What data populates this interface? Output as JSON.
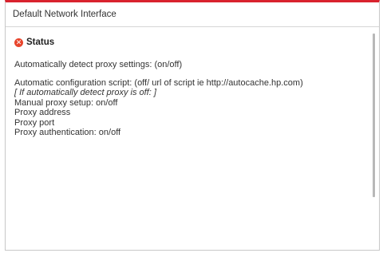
{
  "panel": {
    "title": "Default Network Interface"
  },
  "status": {
    "icon": "error-x-icon",
    "icon_glyph": "✕",
    "icon_color": "#e8452c",
    "title": "Status"
  },
  "lines": {
    "auto_detect": "Automatically detect proxy settings: (on/off)",
    "auto_config": "Automatic configuration script: (off/ url of script ie http://autocache.hp.com)",
    "note": "[ If automatically detect proxy is off: ]",
    "manual_proxy": "Manual proxy setup: on/off",
    "proxy_address": "Proxy address",
    "proxy_port": "Proxy port",
    "proxy_auth": "Proxy authentication: on/off"
  },
  "colors": {
    "accent_top_border": "#d9232e"
  }
}
